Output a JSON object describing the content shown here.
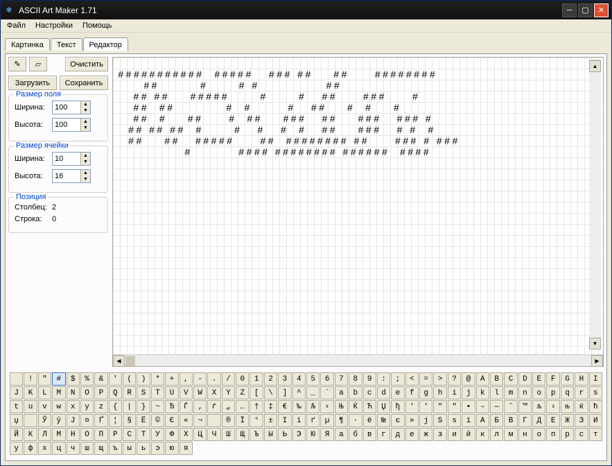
{
  "window": {
    "title": "ASCII Art Maker 1.71"
  },
  "menu": {
    "file": "Файл",
    "settings": "Настройки",
    "help": "Помощь"
  },
  "tabs": {
    "picture": "Картинка",
    "text": "Текст",
    "editor": "Редактор"
  },
  "toolbar": {
    "clear": "Очистить",
    "load": "Загрузить",
    "save": "Сохранить"
  },
  "fieldsize": {
    "legend": "Размер поля",
    "width_label": "Ширина:",
    "height_label": "Высота:",
    "width": "100",
    "height": "100"
  },
  "cellsize": {
    "legend": "Размер ячейки",
    "width_label": "Ширина:",
    "height_label": "Высота:",
    "width": "10",
    "height": "16"
  },
  "position": {
    "legend": "Позиция",
    "col_label": "Столбец:",
    "row_label": "Строка:",
    "col": "2",
    "row": "0"
  },
  "ascii_lines": [
    " ###########  #####   ### ##    ##     ########",
    "      ##        #      # #             ##",
    "    ## ##    #####      #      #   ##     ###     #",
    "    ##  ##          #  #       #   ##    #  #    # ",
    "    ##  #    ##     #  ##    ###   ##    ###   ### #",
    "   ## ## ##  #      #   #   #  #   ##    ###   # #  #",
    "   ##    ##   #####     ##  ######## ##     ### # ### ",
    "              #         #### ######## ######  ####"
  ],
  "palette_rows": [
    [
      " ",
      "!",
      "\"",
      "#",
      "$",
      "%",
      "&",
      "'",
      "(",
      ")",
      "*",
      "+",
      ",",
      "-",
      ".",
      "/",
      "0",
      "1",
      "2",
      "3",
      "4",
      "5",
      "6",
      "7",
      "8",
      "9",
      ":",
      ";",
      "<",
      "=",
      ">",
      "?",
      "@",
      "A",
      "B",
      "C",
      "D",
      "E"
    ],
    [
      "F",
      "G",
      "H",
      "I",
      "J",
      "K",
      "L",
      "M",
      "N",
      "O",
      "P",
      "Q",
      "R",
      "S",
      "T",
      "U",
      "V",
      "W",
      "X",
      "Y",
      "Z",
      "[",
      "\\",
      "]",
      "^",
      "_",
      "`",
      "a",
      "b",
      "c",
      "d",
      "e",
      "f",
      "g",
      "h",
      "i",
      "j",
      "k"
    ],
    [
      "l",
      "m",
      "n",
      "o",
      "p",
      "q",
      "r",
      "s",
      "t",
      "u",
      "v",
      "w",
      "x",
      "y",
      "z",
      "{",
      "|",
      "}",
      "~",
      "Ђ",
      "Ѓ",
      "‚",
      "ѓ",
      "„",
      "…",
      "†",
      "‡",
      "€",
      "‰",
      "Љ",
      "‹",
      "Њ",
      "Ќ",
      "Ћ",
      "Џ",
      "ђ",
      "'",
      "'"
    ],
    [
      "\"",
      "\"",
      "•",
      "–",
      "—",
      "˜",
      "™",
      "љ",
      "›",
      "њ",
      "ќ",
      "ћ",
      "џ",
      " ",
      "Ў",
      "ў",
      "Ј",
      "¤",
      "Ґ",
      "¦",
      "§",
      "Ё",
      "©",
      "Є",
      "«",
      "¬",
      "­",
      "®",
      "Ї",
      "°",
      "±",
      "І",
      "і",
      "ґ",
      "µ",
      "¶",
      "·"
    ],
    [
      "ё",
      "№",
      "є",
      "»",
      "ј",
      "Ѕ",
      "ѕ",
      "ї",
      "А",
      "Б",
      "В",
      "Г",
      "Д",
      "Е",
      "Ж",
      "З",
      "И",
      "Й",
      "К",
      "Л",
      "М",
      "Н",
      "О",
      "П",
      "Р",
      "С",
      "Т",
      "У",
      "Ф",
      "Х",
      "Ц",
      "Ч",
      "Ш",
      "Щ",
      "Ъ",
      "Ы",
      "Ь",
      "Э"
    ],
    [
      "Ю",
      "Я",
      "а",
      "б",
      "в",
      "г",
      "д",
      "е",
      "ж",
      "з",
      "и",
      "й",
      "к",
      "л",
      "м",
      "н",
      "о",
      "п",
      "р",
      "с",
      "т",
      "у",
      "ф",
      "х",
      "ц",
      "ч",
      "ш",
      "щ",
      "ъ",
      "ы",
      "ь",
      "э",
      "ю",
      "я"
    ]
  ],
  "palette_selected": "#"
}
